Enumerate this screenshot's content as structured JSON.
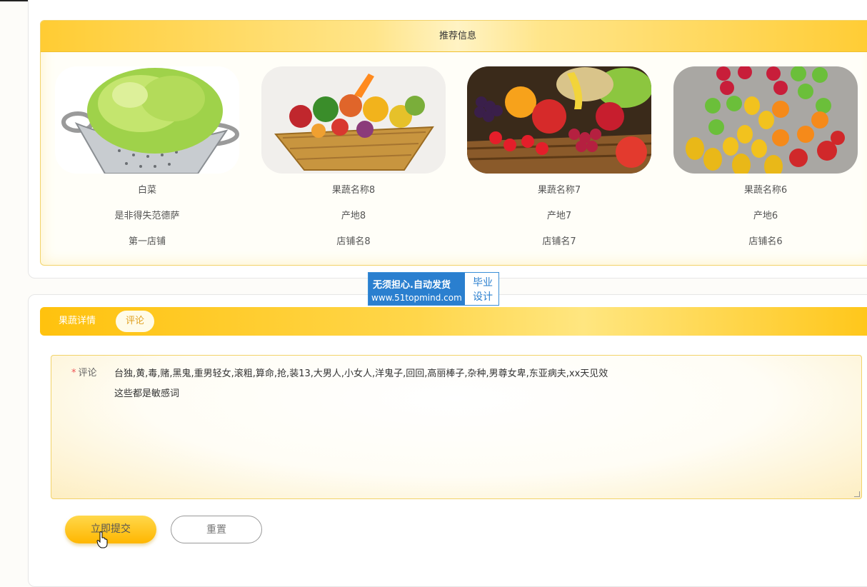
{
  "recommend": {
    "title": "推荐信息",
    "items": [
      {
        "name": "白菜",
        "origin": "是非得失范德萨",
        "shop": "第一店铺",
        "image": "cabbage-in-colander"
      },
      {
        "name": "果蔬名称8",
        "origin": "产地8",
        "shop": "店铺名8",
        "image": "vegetable-basket"
      },
      {
        "name": "果蔬名称7",
        "origin": "产地7",
        "shop": "店铺名7",
        "image": "fruit-basket"
      },
      {
        "name": "果蔬名称6",
        "origin": "产地6",
        "shop": "店铺名6",
        "image": "fruits-on-table"
      }
    ]
  },
  "watermark": {
    "line1": "无须担心.自动发货",
    "line2": "www.51topmind.com",
    "right1": "毕业",
    "right2": "设计"
  },
  "tabs": [
    {
      "label": "果蔬详情"
    },
    {
      "label": "评论"
    }
  ],
  "comment_form": {
    "label": "评论",
    "required_mark": "*",
    "value": "台独,黄,毒,赌,黑鬼,重男轻女,滚粗,算命,抢,装13,大男人,小女人,洋鬼子,回回,高丽棒子,杂种,男尊女卑,东亚病夫,xx天见效\n这些都是敏感词"
  },
  "buttons": {
    "submit": "立即提交",
    "reset": "重置"
  },
  "colors": {
    "accent": "#ffc20e",
    "accent_light": "#fff3c4",
    "required": "#ee5555"
  }
}
